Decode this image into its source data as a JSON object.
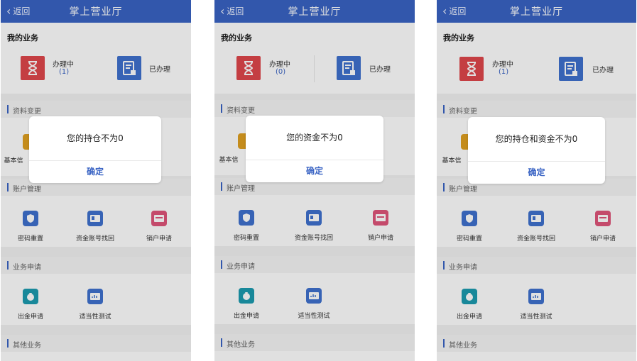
{
  "nav": {
    "back_label": "返回",
    "title": "掌上营业厅"
  },
  "my_business": {
    "heading": "我的业务",
    "processing_label": "办理中",
    "done_label": "已办理"
  },
  "sections": {
    "info_change": "资料变更",
    "account_mgmt": "账户管理",
    "business_apply": "业务申请",
    "other_business": "其他业务"
  },
  "info_change_items": {
    "basic_info_partial": "基本信"
  },
  "account_items": [
    "密码重置",
    "资金账号找回",
    "销户申请"
  ],
  "apply_items": [
    "出金申请",
    "适当性测试"
  ],
  "dialog": {
    "confirm_label": "确定"
  },
  "screens": [
    {
      "processing_count": "(1)",
      "dialog_message": "您的持仓不为0"
    },
    {
      "processing_count": "(0)",
      "dialog_message": "您的资金不为0"
    },
    {
      "processing_count": "(1)",
      "dialog_message": "您的持仓和资金不为0"
    }
  ],
  "colors": {
    "nav": "#3a64c4",
    "accent": "#3a64c4",
    "red": "#e0474c",
    "teal": "#1c9bb0",
    "pink": "#e0557a",
    "orange": "#e0a020"
  }
}
